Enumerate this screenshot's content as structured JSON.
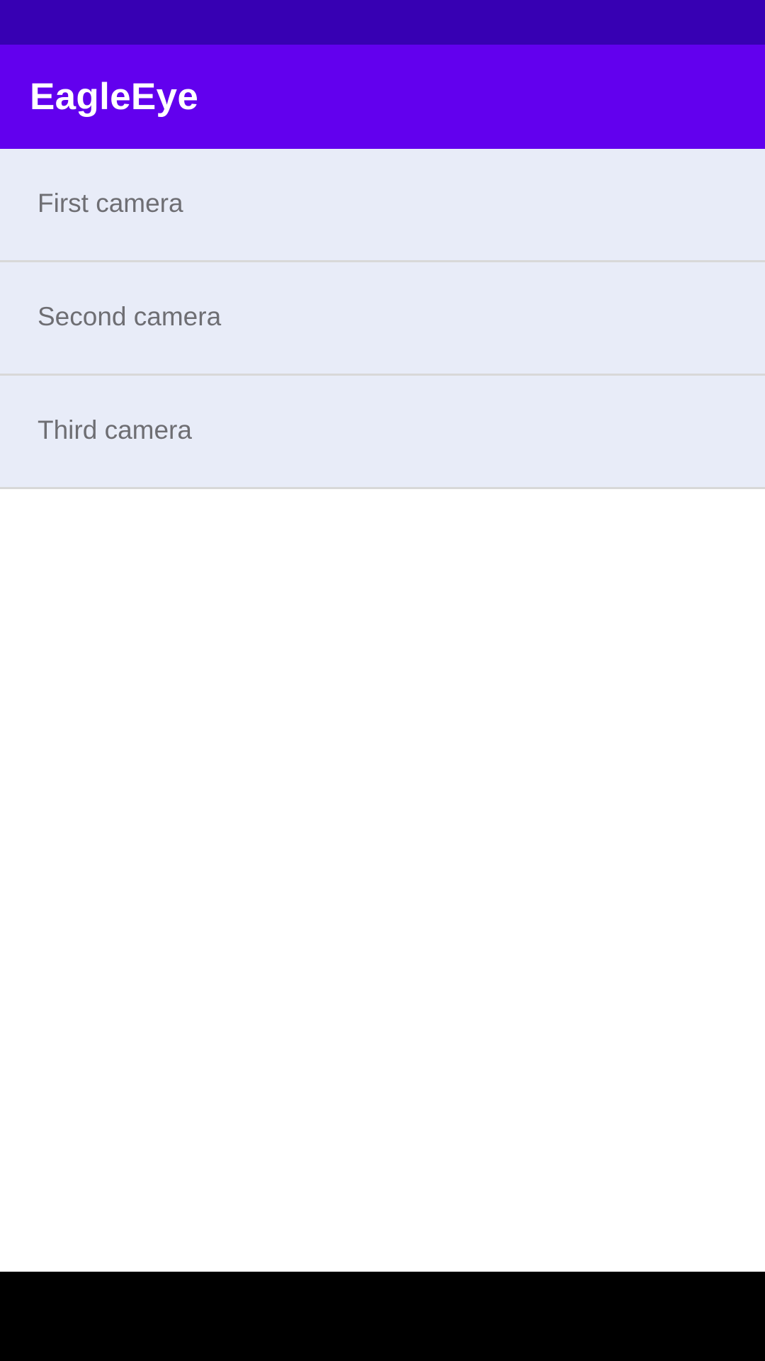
{
  "app": {
    "title": "EagleEye"
  },
  "cameras": [
    {
      "label": "First camera"
    },
    {
      "label": "Second camera"
    },
    {
      "label": "Third camera"
    }
  ],
  "colors": {
    "status_bar": "#3700b3",
    "app_bar": "#6200ee",
    "list_item_background": "#e8ecf8",
    "list_divider": "#d8d8d8",
    "list_text": "#6e6e73",
    "navigation_bar": "#000000"
  }
}
